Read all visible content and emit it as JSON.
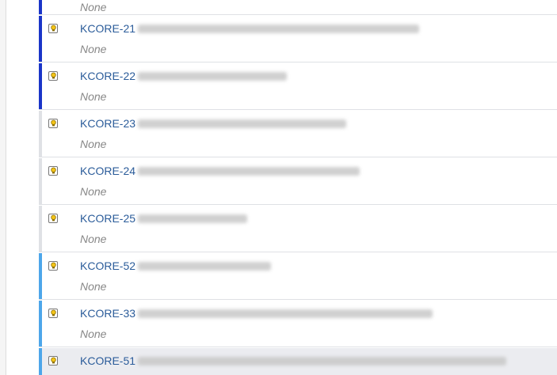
{
  "colors": {
    "rank_dark_blue": "#1a35c8",
    "rank_light_blue": "#4da6ea",
    "rank_none": "#dfe1e5",
    "key_link": "#2b5c9a",
    "none_text": "#888888",
    "selected_row": "#ebecf0"
  },
  "rows": [
    {
      "key": "",
      "sub": "None",
      "rank": "dark-blue"
    },
    {
      "key": "KCORE-21",
      "sub": "None",
      "rank": "dark-blue"
    },
    {
      "key": "KCORE-22",
      "sub": "None",
      "rank": "dark-blue"
    },
    {
      "key": "KCORE-23",
      "sub": "None",
      "rank": "none"
    },
    {
      "key": "KCORE-24",
      "sub": "None",
      "rank": "none"
    },
    {
      "key": "KCORE-25",
      "sub": "None",
      "rank": "none"
    },
    {
      "key": "KCORE-52",
      "sub": "None",
      "rank": "light-blue"
    },
    {
      "key": "KCORE-33",
      "sub": "None",
      "rank": "light-blue"
    },
    {
      "key": "KCORE-51",
      "sub": "",
      "rank": "light-blue",
      "selected": true
    }
  ],
  "icons": {
    "issue_type": "lightbulb-icon"
  }
}
